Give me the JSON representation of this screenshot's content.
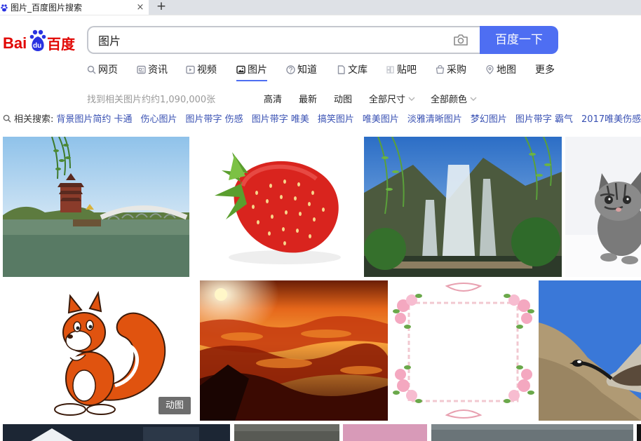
{
  "browser": {
    "tab_title": "图片_百度图片搜索",
    "close_glyph": "×",
    "newtab_glyph": "+"
  },
  "search": {
    "query": "图片",
    "button_label": "百度一下"
  },
  "nav": {
    "items": [
      {
        "label": "网页",
        "icon": "search-icon"
      },
      {
        "label": "资讯",
        "icon": "news-icon"
      },
      {
        "label": "视频",
        "icon": "video-icon"
      },
      {
        "label": "图片",
        "icon": "image-icon",
        "active": true
      },
      {
        "label": "知道",
        "icon": "question-icon"
      },
      {
        "label": "文库",
        "icon": "document-icon"
      },
      {
        "label": "贴吧",
        "icon": "tieba-icon"
      },
      {
        "label": "采购",
        "icon": "cart-icon"
      },
      {
        "label": "地图",
        "icon": "map-pin-icon"
      },
      {
        "label": "更多"
      }
    ],
    "accent": "#4e6ef2"
  },
  "filters": {
    "result_count": "找到相关图片约约1,090,000张",
    "hd": "高清",
    "latest": "最新",
    "animated": "动图",
    "size": "全部尺寸",
    "color": "全部颜色"
  },
  "related": {
    "label": "相关搜索:",
    "items": [
      "背景图片简约 卡通",
      "伤心图片",
      "图片带字 伤感",
      "图片带字 唯美",
      "搞笑图片",
      "唯美图片",
      "淡雅清晰图片",
      "梦幻图片",
      "图片带字 霸气",
      "2017唯美伤感"
    ]
  },
  "results": {
    "gif_badge": "动图"
  }
}
